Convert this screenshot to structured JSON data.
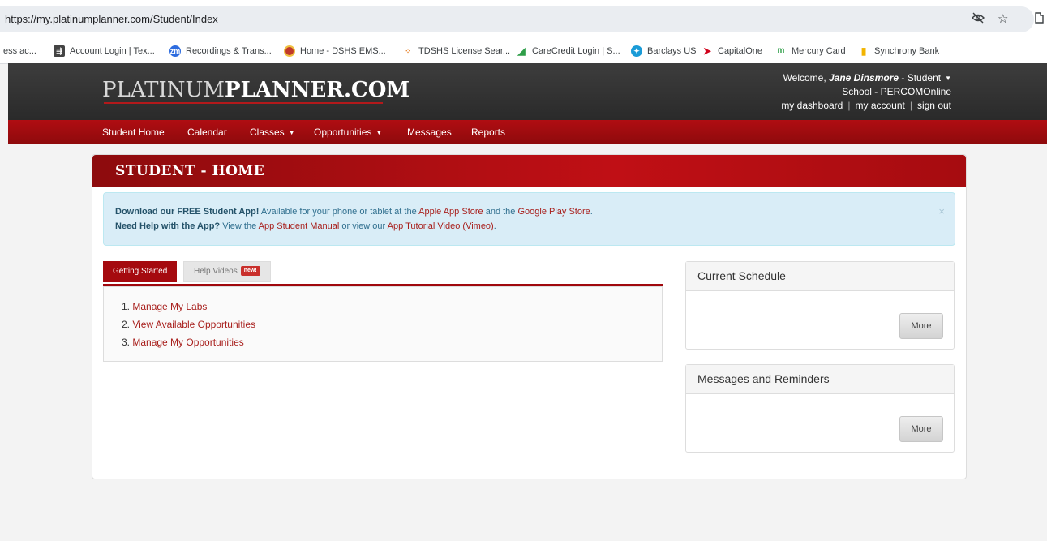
{
  "browser": {
    "url": "https://my.platinumplanner.com/Student/Index",
    "bookmarks": [
      "ess ac...",
      "Account Login | Tex...",
      "Recordings & Trans...",
      "Home - DSHS EMS...",
      "TDSHS License Sear...",
      "CareCredit Login | S...",
      "Barclays US",
      "CapitalOne",
      "Mercury Card",
      "Synchrony Bank"
    ],
    "icon_names": [
      "hide-eye-icon",
      "star-icon",
      "extensions-icon"
    ]
  },
  "header": {
    "logo_part1": "PLATINUM",
    "logo_part2": "PLANNER.COM",
    "welcome_prefix": "Welcome, ",
    "user_name": "Jane Dinsmore",
    "user_role": " - Student",
    "school": "School - PERCOMOnline",
    "links": [
      "my dashboard",
      "my account",
      "sign out"
    ]
  },
  "nav": {
    "items": [
      "Student Home",
      "Calendar",
      "Classes",
      "Opportunities",
      "Messages",
      "Reports"
    ]
  },
  "panel": {
    "title": "STUDENT - HOME"
  },
  "alert": {
    "line1_bold": "Download our FREE Student App!",
    "line1_text": " Available for your phone or tablet at the ",
    "line1_link1": "Apple App Store",
    "line1_and": " and the ",
    "line1_link2": "Google Play Store",
    "line1_end": ".",
    "line2_bold": "Need Help with the App?",
    "line2_text": " View the ",
    "line2_link1": "App Student Manual",
    "line2_or": " or view our ",
    "line2_link2": "App Tutorial Video (Vimeo)",
    "line2_end": ".",
    "close": "×"
  },
  "tabs": {
    "active": "Getting Started",
    "inactive": "Help Videos",
    "new_badge": "new!"
  },
  "getting_started": {
    "items": [
      {
        "num": "1. ",
        "label": "Manage My Labs"
      },
      {
        "num": "2. ",
        "label": "View Available Opportunities"
      },
      {
        "num": "3. ",
        "label": "Manage My Opportunities"
      }
    ]
  },
  "schedule": {
    "title": "Current Schedule",
    "more": "More"
  },
  "messages": {
    "title": "Messages and Reminders",
    "more": "More"
  },
  "colors": {
    "brand_red": "#a50a0f",
    "header_dark": "#2f2f2f",
    "link_red": "#a81f1c",
    "alert_bg": "#d9edf7"
  }
}
